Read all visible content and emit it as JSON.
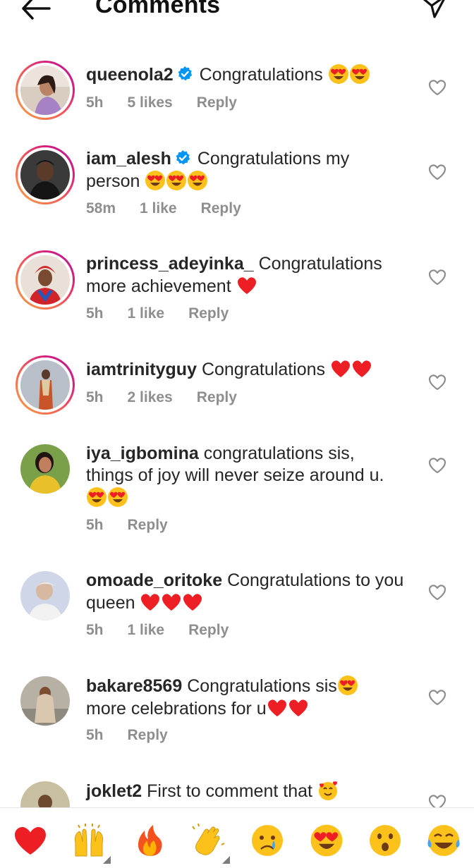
{
  "header": {
    "title": "Comments"
  },
  "comments": [
    {
      "username": "queenola2",
      "verified": true,
      "text": "Congratulations",
      "time": "5h",
      "likes": "5 likes",
      "reply": "Reply"
    },
    {
      "username": "iam_alesh",
      "verified": true,
      "text": "Congratulations my",
      "text2": "person",
      "time": "58m",
      "likes": "1 like",
      "reply": "Reply"
    },
    {
      "username": "princess_adeyinka_",
      "verified": false,
      "text": "Congratulations",
      "text2": "more achievement",
      "time": "5h",
      "likes": "1 like",
      "reply": "Reply"
    },
    {
      "username": "iamtrinityguy",
      "verified": false,
      "text": "Congratulations",
      "time": "5h",
      "likes": "2 likes",
      "reply": "Reply"
    },
    {
      "username": "iya_igbomina",
      "verified": false,
      "text": "congratulations sis,",
      "text2": "things of joy will never seize around u.",
      "time": "5h",
      "reply": "Reply"
    },
    {
      "username": "omoade_oritoke",
      "verified": false,
      "text": "Congratulations to you",
      "text2": "queen",
      "time": "5h",
      "likes": "1 like",
      "reply": "Reply"
    },
    {
      "username": "bakare8569",
      "verified": false,
      "text": "Congratulations sis",
      "text2": "more celebrations for u",
      "time": "5h",
      "reply": "Reply"
    },
    {
      "username": "joklet2",
      "verified": false,
      "text": "First to comment that"
    }
  ],
  "emoji_bar": [
    "red-heart",
    "raising-hands",
    "fire",
    "clapping-hands",
    "crying-face",
    "heart-eyes",
    "surprised-face",
    "tears-of-joy"
  ],
  "colors": {
    "verified": "#0095f6",
    "heart": "#ed1f24",
    "meta": "#8e8e8e",
    "emoji": "#fcc21b"
  }
}
